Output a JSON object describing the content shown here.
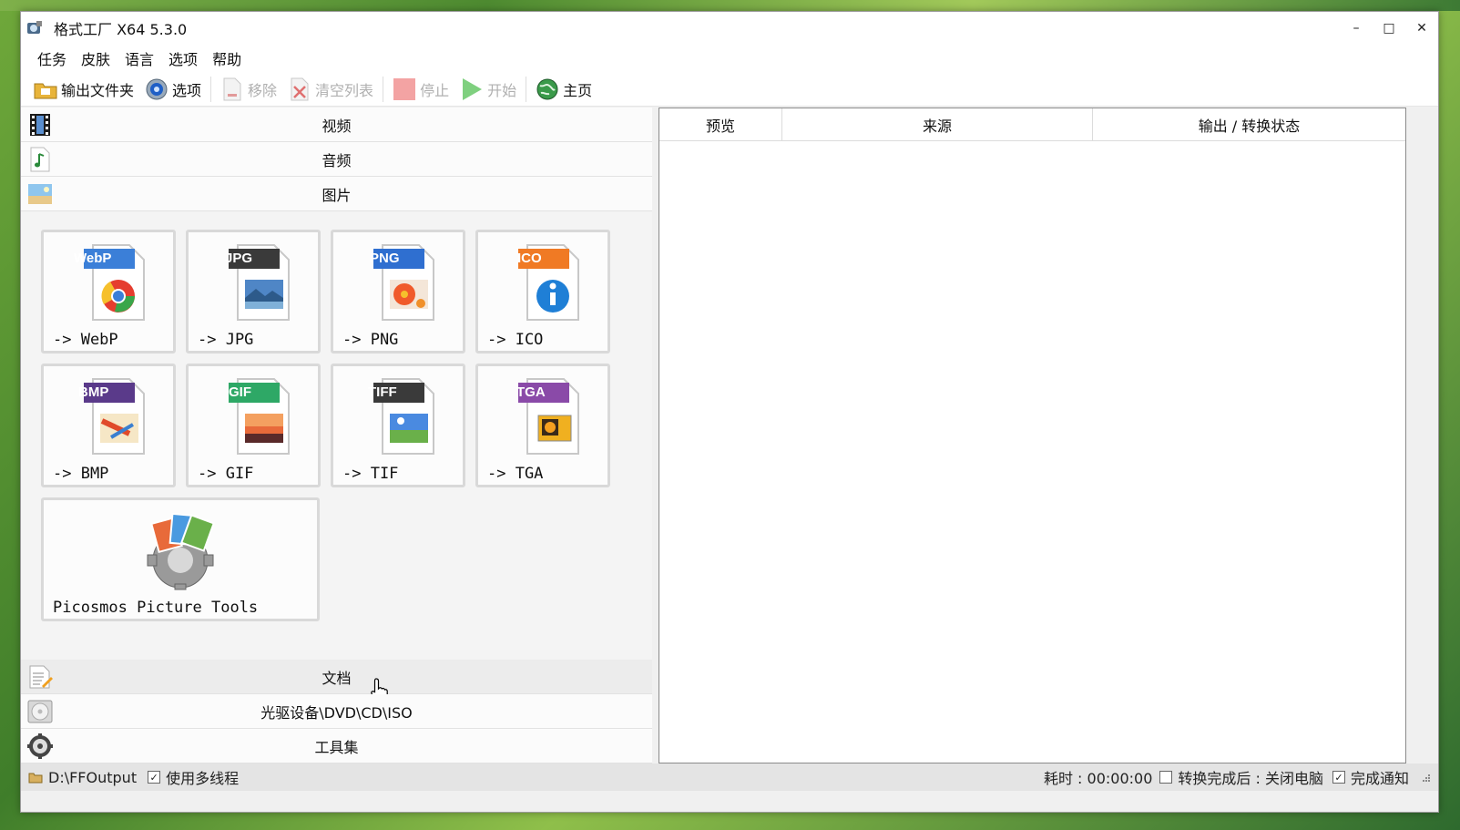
{
  "window": {
    "title": "格式工厂 X64 5.3.0",
    "minimize": "–",
    "maximize": "□",
    "close": "✕"
  },
  "menu": [
    "任务",
    "皮肤",
    "语言",
    "选项",
    "帮助"
  ],
  "toolbar": {
    "output_folder": "输出文件夹",
    "options": "选项",
    "remove": "移除",
    "clear_list": "清空列表",
    "stop": "停止",
    "start": "开始",
    "home": "主页"
  },
  "categories": {
    "video": "视频",
    "audio": "音频",
    "image": "图片",
    "document": "文档",
    "disc": "光驱设备\\DVD\\CD\\ISO",
    "tools": "工具集"
  },
  "image_tools": [
    {
      "badge": "WebP",
      "label": "-> WebP",
      "badge_color": "#3b7fd8"
    },
    {
      "badge": "JPG",
      "label": "-> JPG",
      "badge_color": "#3a3a3a"
    },
    {
      "badge": "PNG",
      "label": "-> PNG",
      "badge_color": "#2f6fd0"
    },
    {
      "badge": "ICO",
      "label": "-> ICO",
      "badge_color": "#f07a24"
    },
    {
      "badge": "BMP",
      "label": "-> BMP",
      "badge_color": "#5a3a8a"
    },
    {
      "badge": "GIF",
      "label": "-> GIF",
      "badge_color": "#2ea866"
    },
    {
      "badge": "TIFF",
      "label": "-> TIF",
      "badge_color": "#3a3a3a"
    },
    {
      "badge": "TGA",
      "label": "-> TGA",
      "badge_color": "#8a4aa8"
    }
  ],
  "picosmos": {
    "label": "Picosmos Picture Tools"
  },
  "table": {
    "columns": [
      "预览",
      "来源",
      "输出 / 转换状态"
    ]
  },
  "status": {
    "folder": "D:\\FFOutput",
    "multithread": "使用多线程",
    "elapsed": "耗时 : 00:00:00",
    "shutdown": "转换完成后 : 关闭电脑",
    "notify": "完成通知",
    "multithread_checked": "✓",
    "notify_checked": "✓"
  }
}
